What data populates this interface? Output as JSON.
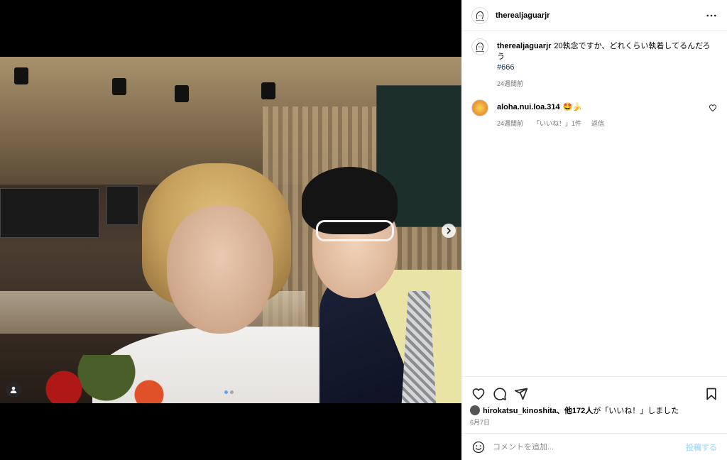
{
  "post": {
    "author": "therealjaguarjr",
    "media": {
      "alt": "",
      "carousel_total": 2,
      "carousel_index": 1
    }
  },
  "header": {
    "username": "therealjaguarjr",
    "more_icon": "more-horizontal-icon"
  },
  "comments": [
    {
      "username": "therealjaguarjr",
      "text": "20執念ですか、どれくらい執着してるんだろう",
      "hashtag": "#666",
      "time": "24週間前"
    },
    {
      "username": "aloha.nui.loa.314",
      "text": "🤩🍌",
      "time": "24週間前",
      "likes_label": "「いいね！」1件",
      "reply_label": "返信"
    }
  ],
  "actions": {
    "like_icon": "heart-icon",
    "comment_icon": "comment-icon",
    "share_icon": "share-icon",
    "save_icon": "bookmark-icon"
  },
  "likes": {
    "user": "hirokatsu_kinoshita",
    "rest": "、他172人",
    "suffix": "が「いいね！」しました"
  },
  "date": "6月7日",
  "add_comment": {
    "placeholder": "コメントを追加...",
    "post_label": "投稿する",
    "emoji_icon": "emoji-icon"
  },
  "colors": {
    "link": "#00376b",
    "muted": "#737373",
    "post_button": "#b2dffc"
  }
}
